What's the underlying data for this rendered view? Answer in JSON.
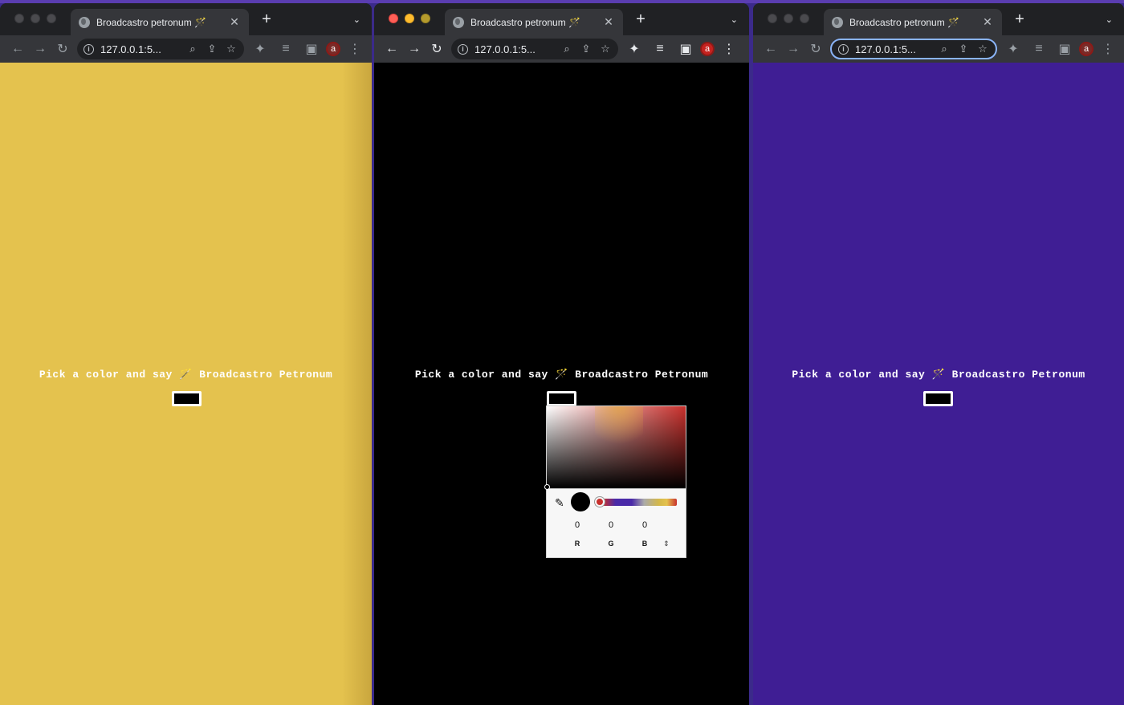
{
  "tab_title": "Broadcastro petronum ",
  "tab_emoji": "🪄",
  "url": "127.0.0.1:5...",
  "avatar_letter": "a",
  "prompt": "Pick a color and say 🪄 Broadcastro Petronum",
  "icons": {
    "close": "✕",
    "new_tab": "+",
    "tab_menu": "⌄",
    "back": "←",
    "forward": "→",
    "reload": "↻",
    "info": "i",
    "zoom": "⌕",
    "share": "⇪",
    "star": "☆",
    "extensions": "✦",
    "media": "≡",
    "sidepanel": "▣",
    "menu": "⋮",
    "dropper": "✎",
    "format_toggle": "⇕"
  },
  "windows": [
    {
      "id": "w1",
      "background": "#e4c24e",
      "focused": false
    },
    {
      "id": "w2",
      "background": "#000000",
      "focused": true
    },
    {
      "id": "w3",
      "background": "#3f1e94",
      "focused": false
    }
  ],
  "color_picker": {
    "r": "0",
    "g": "0",
    "b": "0",
    "r_label": "R",
    "g_label": "G",
    "b_label": "B",
    "selected_color": "#000000"
  }
}
